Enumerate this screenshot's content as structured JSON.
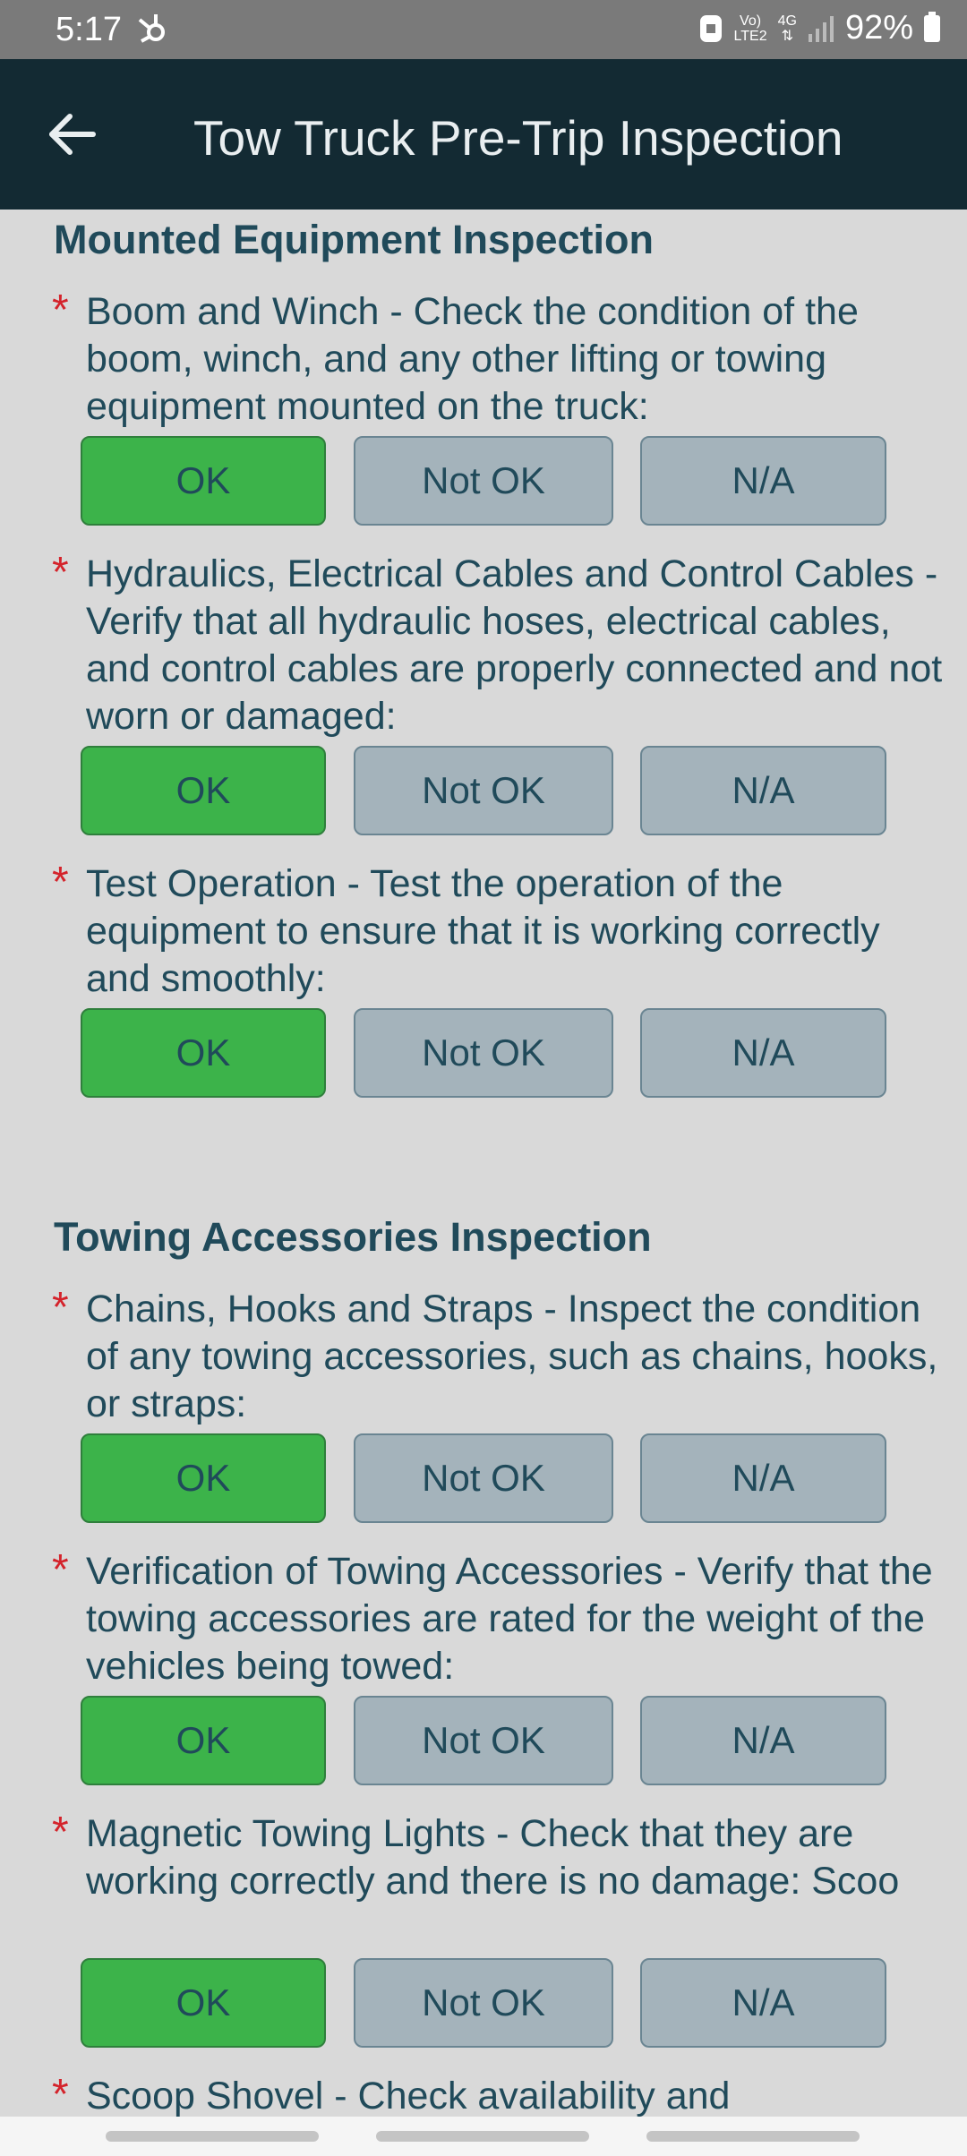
{
  "status_bar": {
    "time": "5:17",
    "network_top": "Vo)",
    "network_bottom": "LTE2",
    "signal_top": "4G",
    "battery": "92%"
  },
  "app_bar": {
    "title": "Tow Truck Pre-Trip Inspection"
  },
  "sections": [
    {
      "title": "Mounted Equipment Inspection",
      "questions": [
        {
          "text": "Boom and Winch - Check the condition of the boom, winch, and any other lifting or towing equipment mounted on the truck:",
          "selected": "OK"
        },
        {
          "text": "Hydraulics, Electrical Cables and Control Cables - Verify that all hydraulic hoses, electrical cables, and control cables are properly connected and not worn or damaged:",
          "selected": "OK"
        },
        {
          "text": " Test Operation - Test the operation of the equipment to ensure that it is working correctly and smoothly:",
          "selected": "OK"
        }
      ]
    },
    {
      "title": "Towing Accessories Inspection",
      "questions": [
        {
          "text": "Chains, Hooks and Straps - Inspect the condition of any towing accessories, such as chains, hooks, or straps:",
          "selected": "OK"
        },
        {
          "text": " Verification of Towing Accessories - Verify that the towing accessories are rated for the weight of the vehicles being towed:",
          "selected": "OK"
        },
        {
          "text": " Magnetic Towing Lights - Check that they are working correctly and there is no damage: Scoo",
          "selected": "OK"
        },
        {
          "text": "Scoop Shovel - Check availability and",
          "selected": ""
        }
      ]
    }
  ],
  "buttons": {
    "ok": "OK",
    "not_ok": "Not OK",
    "na": "N/A"
  },
  "colors": {
    "app_bar": "#132a33",
    "ok_selected": "#3cb34a",
    "unselected": "#a4b3bb",
    "text": "#204a5a",
    "required": "#d4232b"
  }
}
